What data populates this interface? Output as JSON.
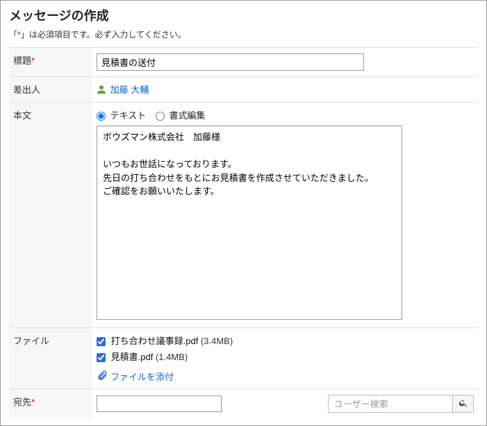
{
  "title": "メッセージの作成",
  "required_note_prefix": "「",
  "required_mark": "*",
  "required_note_suffix": "」は必須項目です。必ず入力してください。",
  "labels": {
    "subject": "標題",
    "sender": "差出人",
    "body": "本文",
    "file": "ファイル",
    "dest": "宛先"
  },
  "subject_value": "見積書の送付",
  "sender_name": "加藤 大輔",
  "body_mode": {
    "text": "テキスト",
    "format": "書式編集"
  },
  "body_value": "ボウズマン株式会社　加藤様\n\nいつもお世話になっております。\n先日の打ち合わせをもとにお見積書を作成させていただきました。\nご確認をお願いいたします。",
  "files": [
    {
      "name": "打ち合わせ議事録.pdf",
      "size": "(3.4MB)",
      "checked": true
    },
    {
      "name": "見積書.pdf",
      "size": "(1.4MB)",
      "checked": true
    }
  ],
  "attach_label": "ファイルを添付",
  "dest_value": "",
  "search_placeholder": "ユーザー検索"
}
